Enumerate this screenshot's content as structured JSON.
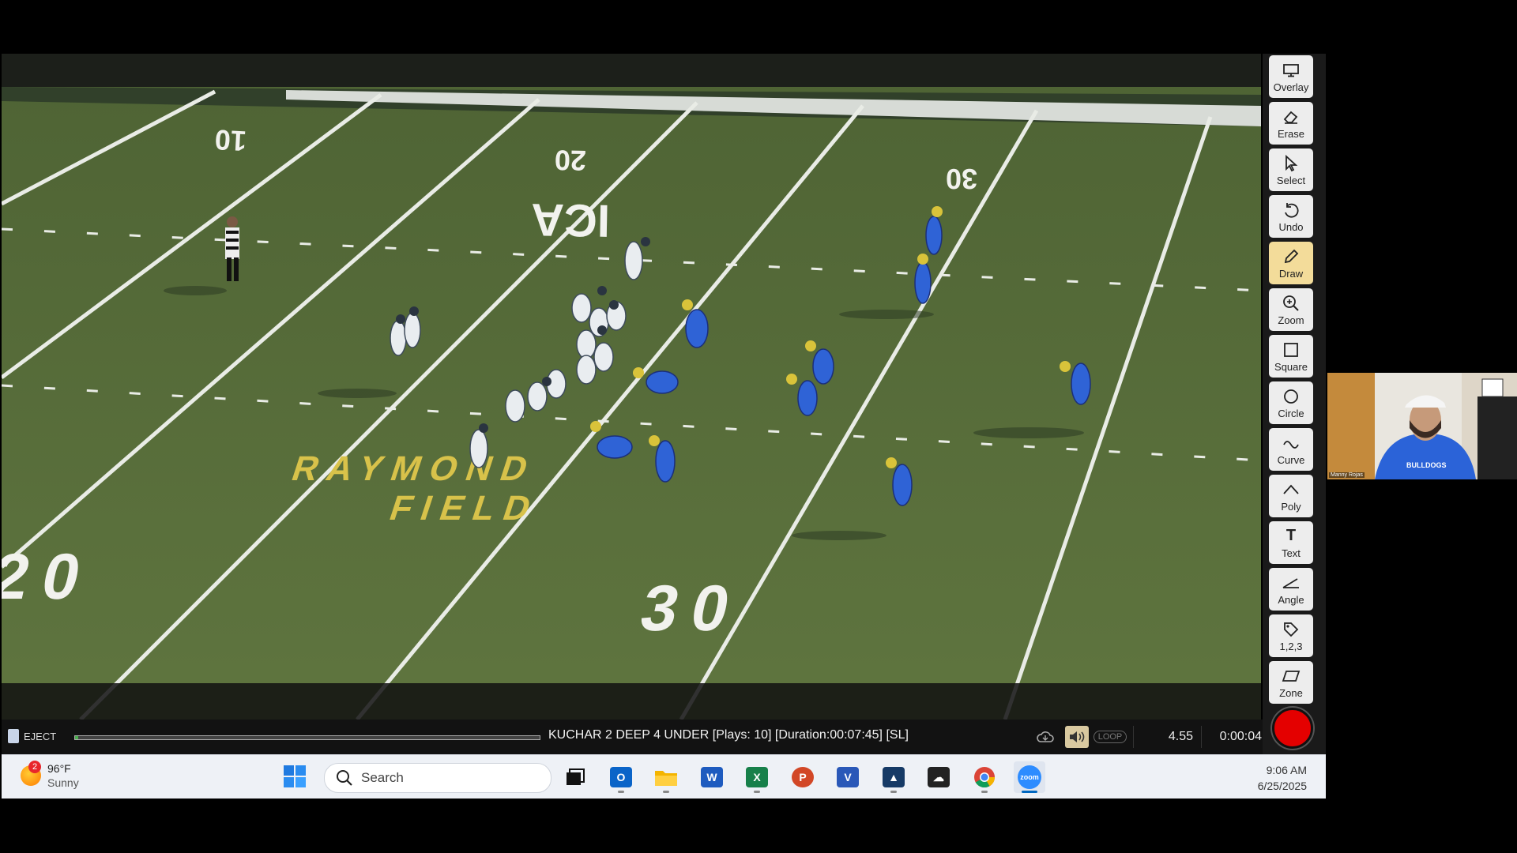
{
  "video": {
    "yard_numbers_far": [
      "10",
      "20",
      "30"
    ],
    "yard_numbers_near": [
      "20",
      "30"
    ],
    "midfield_logo": "ICA",
    "endzone_text_line1": "RAYMOND",
    "endzone_text_line2": "FIELD"
  },
  "playbar": {
    "eject_label": "EJECT",
    "progress_fraction": 0.005,
    "clip_title": "KUCHAR 2 DEEP 4 UNDER   [Plays: 10] [Duration:00:07:45] [SL]",
    "loop_label": "LOOP",
    "speed": "4.55",
    "timecode": "0:00:04"
  },
  "tools": [
    {
      "label": "Overlay",
      "icon": "monitor-icon",
      "active": false
    },
    {
      "label": "Erase",
      "icon": "eraser-icon",
      "active": false
    },
    {
      "label": "Select",
      "icon": "cursor-icon",
      "active": false
    },
    {
      "label": "Undo",
      "icon": "undo-icon",
      "active": false
    },
    {
      "label": "Draw",
      "icon": "pencil-icon",
      "active": true
    },
    {
      "label": "Zoom",
      "icon": "magnifier-icon",
      "active": false
    },
    {
      "label": "Square",
      "icon": "square-icon",
      "active": false
    },
    {
      "label": "Circle",
      "icon": "circle-icon",
      "active": false
    },
    {
      "label": "Curve",
      "icon": "curve-icon",
      "active": false
    },
    {
      "label": "Poly",
      "icon": "poly-icon",
      "active": false
    },
    {
      "label": "Text",
      "icon": "text-icon",
      "active": false
    },
    {
      "label": "Angle",
      "icon": "angle-icon",
      "active": false
    },
    {
      "label": "1,2,3",
      "icon": "tag-icon",
      "active": false
    },
    {
      "label": "Zone",
      "icon": "parallelogram-icon",
      "active": false
    }
  ],
  "taskbar": {
    "weather_badge": "2",
    "temperature": "96°F",
    "condition": "Sunny",
    "search_placeholder": "Search",
    "time": "9:06 AM",
    "date": "6/25/2025",
    "apps": [
      "Task View",
      "Outlook",
      "File Explorer",
      "Word",
      "Excel",
      "PowerPoint",
      "Visio",
      "Hudl",
      "OneDrive",
      "Chrome",
      "Zoom"
    ]
  },
  "webcam": {
    "name_label": "Manny Rojas",
    "shirt_text": "BULLDOGS"
  },
  "colors": {
    "turf": "#566c3a",
    "tool_active": "#f3dc9a",
    "record": "#e40000",
    "taskbar": "#eef1f6"
  }
}
